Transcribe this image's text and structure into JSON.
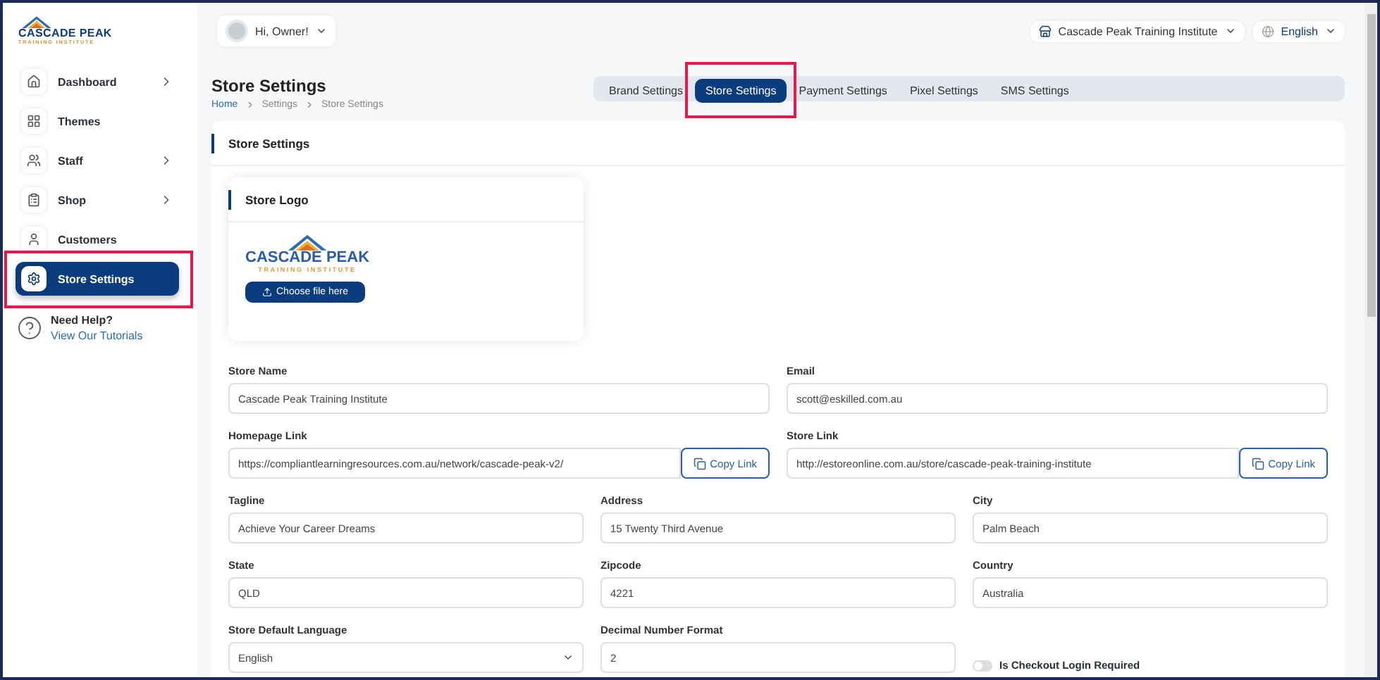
{
  "brand": {
    "name": "CASCADE PEAK",
    "subtitle": "TRAINING INSTITUTE"
  },
  "user_menu": {
    "greeting": "Hi, Owner!"
  },
  "store_picker": {
    "label": "Cascade Peak Training Institute"
  },
  "language_picker": {
    "label": "English"
  },
  "sidebar": {
    "items": [
      {
        "label": "Dashboard",
        "has_submenu": true,
        "selected": false,
        "highlighted": false
      },
      {
        "label": "Themes",
        "has_submenu": false,
        "selected": false,
        "highlighted": false
      },
      {
        "label": "Staff",
        "has_submenu": true,
        "selected": false,
        "highlighted": false
      },
      {
        "label": "Shop",
        "has_submenu": true,
        "selected": false,
        "highlighted": false
      },
      {
        "label": "Customers",
        "has_submenu": false,
        "selected": false,
        "highlighted": false
      },
      {
        "label": "Store Settings",
        "has_submenu": false,
        "selected": true,
        "highlighted": true
      }
    ]
  },
  "help": {
    "title": "Need Help?",
    "link": "View Our Tutorials"
  },
  "page": {
    "title": "Store Settings",
    "breadcrumb": [
      {
        "label": "Home",
        "link": true
      },
      {
        "label": "Settings",
        "link": false
      },
      {
        "label": "Store Settings",
        "link": false
      }
    ]
  },
  "tabs": [
    {
      "label": "Brand Settings",
      "selected": false,
      "highlighted": false
    },
    {
      "label": "Store Settings",
      "selected": true,
      "highlighted": true
    },
    {
      "label": "Payment Settings",
      "selected": false,
      "highlighted": false
    },
    {
      "label": "Pixel Settings",
      "selected": false,
      "highlighted": false
    },
    {
      "label": "SMS Settings",
      "selected": false,
      "highlighted": false
    }
  ],
  "card_title": "Store Settings",
  "logo_card": {
    "title": "Store Logo",
    "logo": {
      "name": "CASCADE PEAK",
      "subtitle": "TRAINING INSTITUTE"
    },
    "button": "Choose file here"
  },
  "form_rows": [
    [
      {
        "kind": "text",
        "label": "Store Name",
        "value": "Cascade Peak Training Institute"
      },
      {
        "kind": "text",
        "label": "Email",
        "value": "scott@eskilled.com.au"
      }
    ],
    [
      {
        "kind": "link",
        "label": "Homepage Link",
        "value": "https://compliantlearningresources.com.au/network/cascade-peak-v2/",
        "button": "Copy Link"
      },
      {
        "kind": "link",
        "label": "Store Link",
        "value": "http://estoreonline.com.au/store/cascade-peak-training-institute",
        "button": "Copy Link"
      }
    ],
    [
      {
        "kind": "text",
        "label": "Tagline",
        "value": "Achieve Your Career Dreams"
      },
      {
        "kind": "text",
        "label": "Address",
        "value": "15 Twenty Third Avenue"
      },
      {
        "kind": "text",
        "label": "City",
        "value": "Palm Beach"
      }
    ],
    [
      {
        "kind": "text",
        "label": "State",
        "value": "QLD"
      },
      {
        "kind": "text",
        "label": "Zipcode",
        "value": "4221"
      },
      {
        "kind": "text",
        "label": "Country",
        "value": "Australia"
      }
    ],
    [
      {
        "kind": "select",
        "label": "Store Default Language",
        "value": "English"
      },
      {
        "kind": "text",
        "label": "Decimal Number Format",
        "value": "2"
      },
      {
        "kind": "toggle",
        "label": "Is Checkout Login Required",
        "on": false
      }
    ]
  ]
}
